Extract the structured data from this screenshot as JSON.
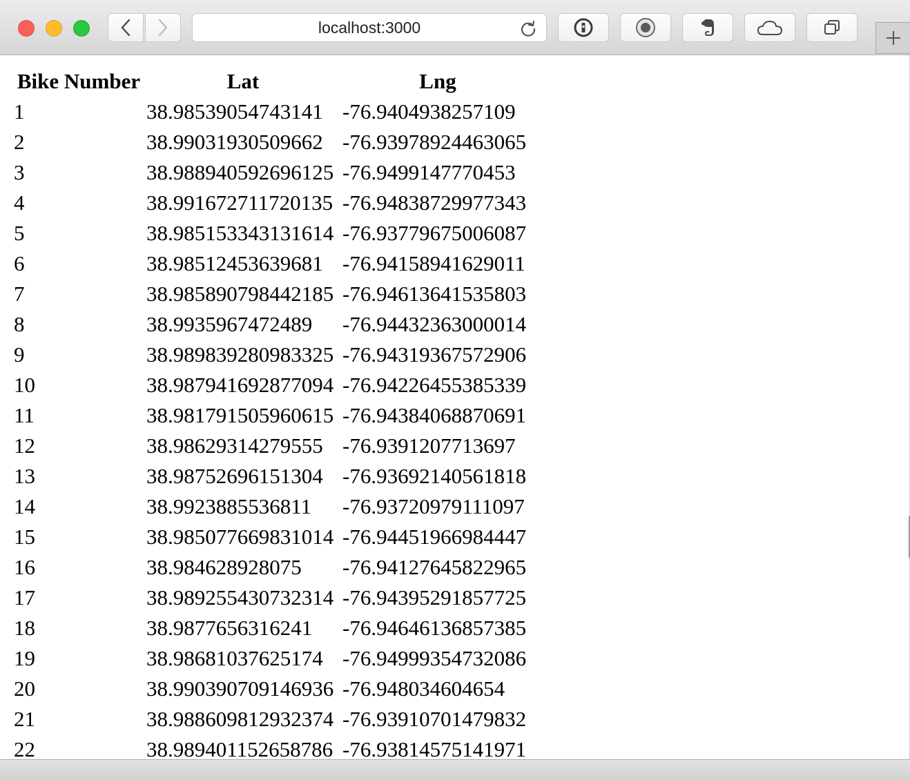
{
  "browser": {
    "url": "localhost:3000",
    "controls": {
      "close": "close-button",
      "minimize": "minimize-button",
      "zoom": "zoom-button"
    },
    "extension_icons": [
      "1password-icon",
      "record-icon",
      "evernote-icon",
      "cloud-icon",
      "tabs-icon"
    ]
  },
  "table": {
    "headers": {
      "bike_number": "Bike Number",
      "lat": "Lat",
      "lng": "Lng"
    },
    "rows": [
      {
        "bike": "1",
        "lat": "38.98539054743141",
        "lng": "-76.9404938257109"
      },
      {
        "bike": "2",
        "lat": "38.99031930509662",
        "lng": "-76.93978924463065"
      },
      {
        "bike": "3",
        "lat": "38.988940592696125",
        "lng": "-76.9499147770453"
      },
      {
        "bike": "4",
        "lat": "38.991672711720135",
        "lng": "-76.94838729977343"
      },
      {
        "bike": "5",
        "lat": "38.985153343131614",
        "lng": "-76.93779675006087"
      },
      {
        "bike": "6",
        "lat": "38.98512453639681",
        "lng": "-76.94158941629011"
      },
      {
        "bike": "7",
        "lat": "38.985890798442185",
        "lng": "-76.94613641535803"
      },
      {
        "bike": "8",
        "lat": "38.9935967472489",
        "lng": "-76.94432363000014"
      },
      {
        "bike": "9",
        "lat": "38.989839280983325",
        "lng": "-76.94319367572906"
      },
      {
        "bike": "10",
        "lat": "38.987941692877094",
        "lng": "-76.94226455385339"
      },
      {
        "bike": "11",
        "lat": "38.981791505960615",
        "lng": "-76.94384068870691"
      },
      {
        "bike": "12",
        "lat": "38.98629314279555",
        "lng": "-76.9391207713697"
      },
      {
        "bike": "13",
        "lat": "38.98752696151304",
        "lng": "-76.93692140561818"
      },
      {
        "bike": "14",
        "lat": "38.9923885536811",
        "lng": "-76.93720979111097"
      },
      {
        "bike": "15",
        "lat": "38.985077669831014",
        "lng": "-76.94451966984447"
      },
      {
        "bike": "16",
        "lat": "38.984628928075",
        "lng": "-76.94127645822965"
      },
      {
        "bike": "17",
        "lat": "38.989255430732314",
        "lng": "-76.94395291857725"
      },
      {
        "bike": "18",
        "lat": "38.9877656316241",
        "lng": "-76.94646136857385"
      },
      {
        "bike": "19",
        "lat": "38.98681037625174",
        "lng": "-76.94999354732086"
      },
      {
        "bike": "20",
        "lat": "38.990390709146936",
        "lng": "-76.948034604654"
      },
      {
        "bike": "21",
        "lat": "38.988609812932374",
        "lng": "-76.93910701479832"
      },
      {
        "bike": "22",
        "lat": "38.989401152658786",
        "lng": "-76.93814575141971"
      }
    ]
  }
}
